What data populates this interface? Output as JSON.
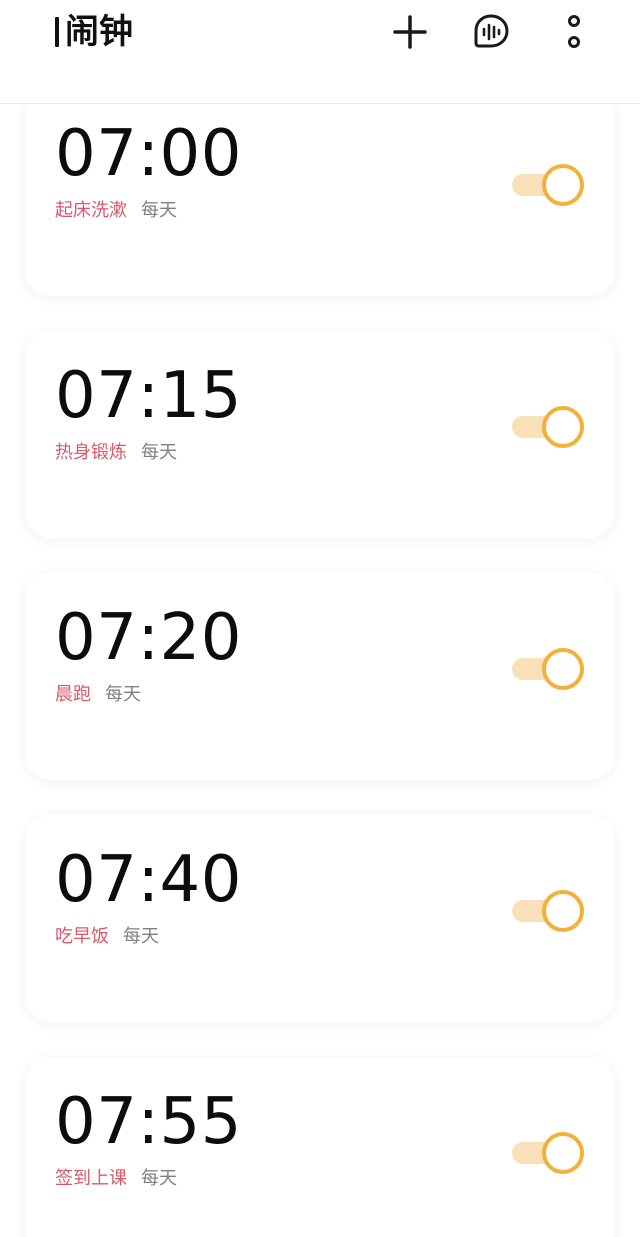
{
  "header": {
    "title": "闹钟",
    "add_icon": "plus-icon",
    "feedback_icon": "voice-bubble-icon",
    "more_icon": "more-vertical-icon"
  },
  "colors": {
    "accent": "#f1b13b",
    "label": "#d9596b",
    "text": "#0c0c0c"
  },
  "alarms": [
    {
      "time": "07:00",
      "label": "起床洗漱",
      "repeat": "每天",
      "enabled": true
    },
    {
      "time": "07:15",
      "label": "热身锻炼",
      "repeat": "每天",
      "enabled": true
    },
    {
      "time": "07:20",
      "label": "晨跑",
      "repeat": "每天",
      "enabled": true
    },
    {
      "time": "07:40",
      "label": "吃早饭",
      "repeat": "每天",
      "enabled": true
    },
    {
      "time": "07:55",
      "label": "签到上课",
      "repeat": "每天",
      "enabled": true
    }
  ]
}
